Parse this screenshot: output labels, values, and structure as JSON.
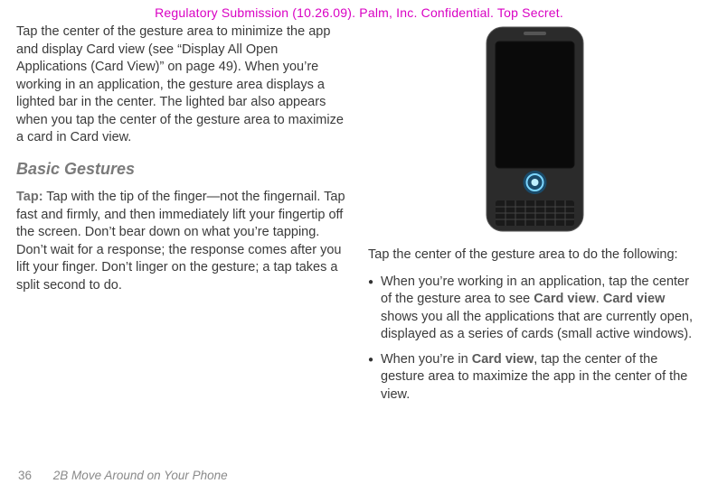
{
  "header": {
    "notice": "Regulatory Submission (10.26.09). Palm, Inc. Confidential. Top Secret."
  },
  "left": {
    "intro": "Tap the center of the gesture area to minimize the app and display Card view (see “Display All Open Applications (Card View)” on page 49).  When you’re working in an application, the gesture area displays a lighted bar in the center. The lighted bar also appears when you tap the center of the gesture area to maximize a card in Card view.",
    "heading": "Basic Gestures",
    "tap_label": "Tap:",
    "tap_body": " Tap with the tip of the finger—not the fingernail. Tap fast and firmly, and then immediately lift your fingertip off the screen. Don’t bear down on what you’re tapping. Don’t wait for a response; the response comes after you lift your finger. Don’t linger on the gesture; a tap takes a split second to do."
  },
  "right": {
    "caption": "Tap the center of the gesture area to do the following:",
    "bullets": {
      "b1": {
        "p1": "When you’re working in an application, tap the center of the gesture area to see ",
        "cv1": "Card view",
        "p2": ". ",
        "cv2": "Card view",
        "p3": " shows you all the applications that are currently open, displayed as a series of cards (small active windows)."
      },
      "b2": {
        "p1": "When you’re in ",
        "cv": "Card view",
        "p2": ", tap the center of the gesture area to maximize the app in the center of the view."
      }
    }
  },
  "footer": {
    "page": "36",
    "chapter": "2B Move Around on Your Phone"
  }
}
